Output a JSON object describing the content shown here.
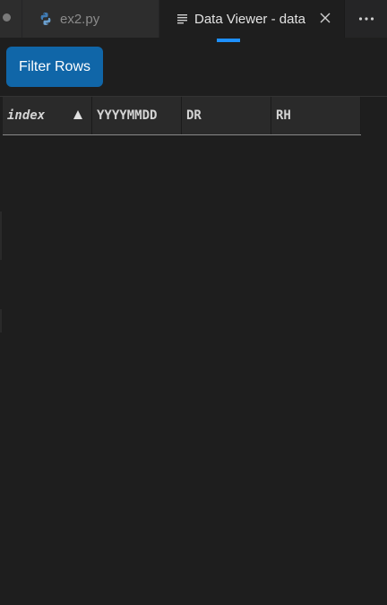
{
  "tabs": {
    "inactive": {
      "label": "ex2.py",
      "icon": "python-icon"
    },
    "active": {
      "label": "Data Viewer - data",
      "icon": "document-lines-icon",
      "close_icon": "close-icon"
    },
    "more_icon": "ellipsis-icon"
  },
  "toolbar": {
    "filter_label": "Filter Rows"
  },
  "grid": {
    "columns": [
      {
        "label": "index",
        "sort": "ascending"
      },
      {
        "label": "YYYYMMDD"
      },
      {
        "label": "DR"
      },
      {
        "label": "RH"
      }
    ],
    "rows": []
  },
  "colors": {
    "accent": "#1e90ff",
    "button": "#1066a8",
    "background": "#1e1e1e"
  }
}
